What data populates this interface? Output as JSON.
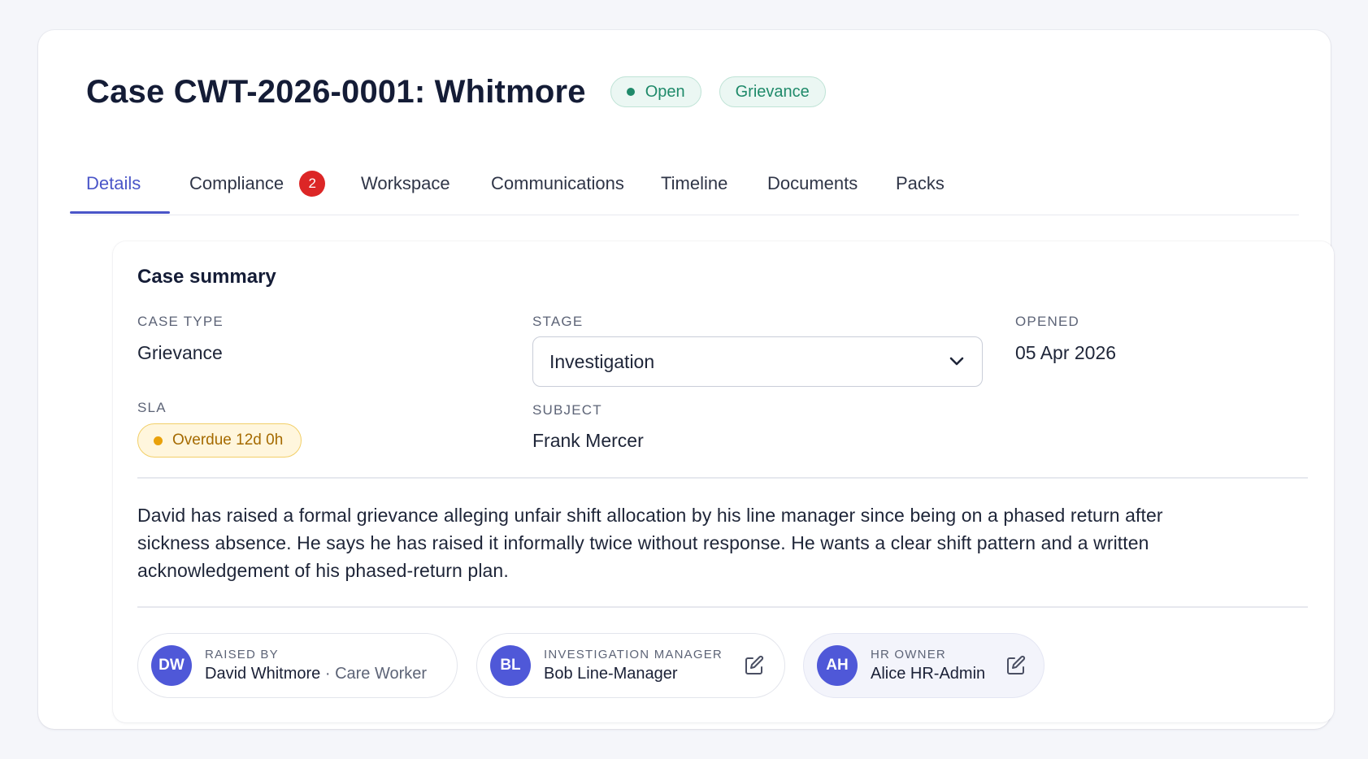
{
  "case": {
    "title": "Case CWT-2026-0001: Whitmore",
    "status": "Open",
    "type_badge": "Grievance"
  },
  "tabs": [
    {
      "label": "Details",
      "active": true
    },
    {
      "label": "Compliance",
      "badge": "2"
    },
    {
      "label": "Workspace"
    },
    {
      "label": "Communications"
    },
    {
      "label": "Timeline"
    },
    {
      "label": "Documents"
    },
    {
      "label": "Packs"
    }
  ],
  "summary": {
    "title": "Case summary",
    "case_type_label": "CASE TYPE",
    "case_type": "Grievance",
    "stage_label": "STAGE",
    "stage": "Investigation",
    "opened_label": "OPENED",
    "opened": "05 Apr 2026",
    "sla_label": "SLA",
    "sla": "Overdue 12d 0h",
    "subject_label": "SUBJECT",
    "subject": "Frank Mercer",
    "description": "David has raised a formal grievance alleging unfair shift allocation by his line manager since being on a phased return after sickness absence. He says he has raised it informally twice without response. He wants a clear shift pattern and a written acknowledgement of his phased-return plan."
  },
  "people": [
    {
      "initials": "DW",
      "role": "RAISED BY",
      "name": "David Whitmore",
      "sep": "·",
      "detail": "Care Worker"
    },
    {
      "initials": "BL",
      "role": "INVESTIGATION MANAGER",
      "name": "Bob Line-Manager"
    },
    {
      "initials": "AH",
      "role": "HR OWNER",
      "name": "Alice HR-Admin"
    }
  ],
  "icons": {
    "edit": "pencil-square-icon",
    "chevron": "chevron-down-icon",
    "status_dot": "dot-icon"
  },
  "colors": {
    "accent": "#4a55c8",
    "open_green": "#1f8a6a",
    "badge_red": "#dc2626",
    "warning_amber": "#e9a10a",
    "avatar": "#4f58d8"
  }
}
